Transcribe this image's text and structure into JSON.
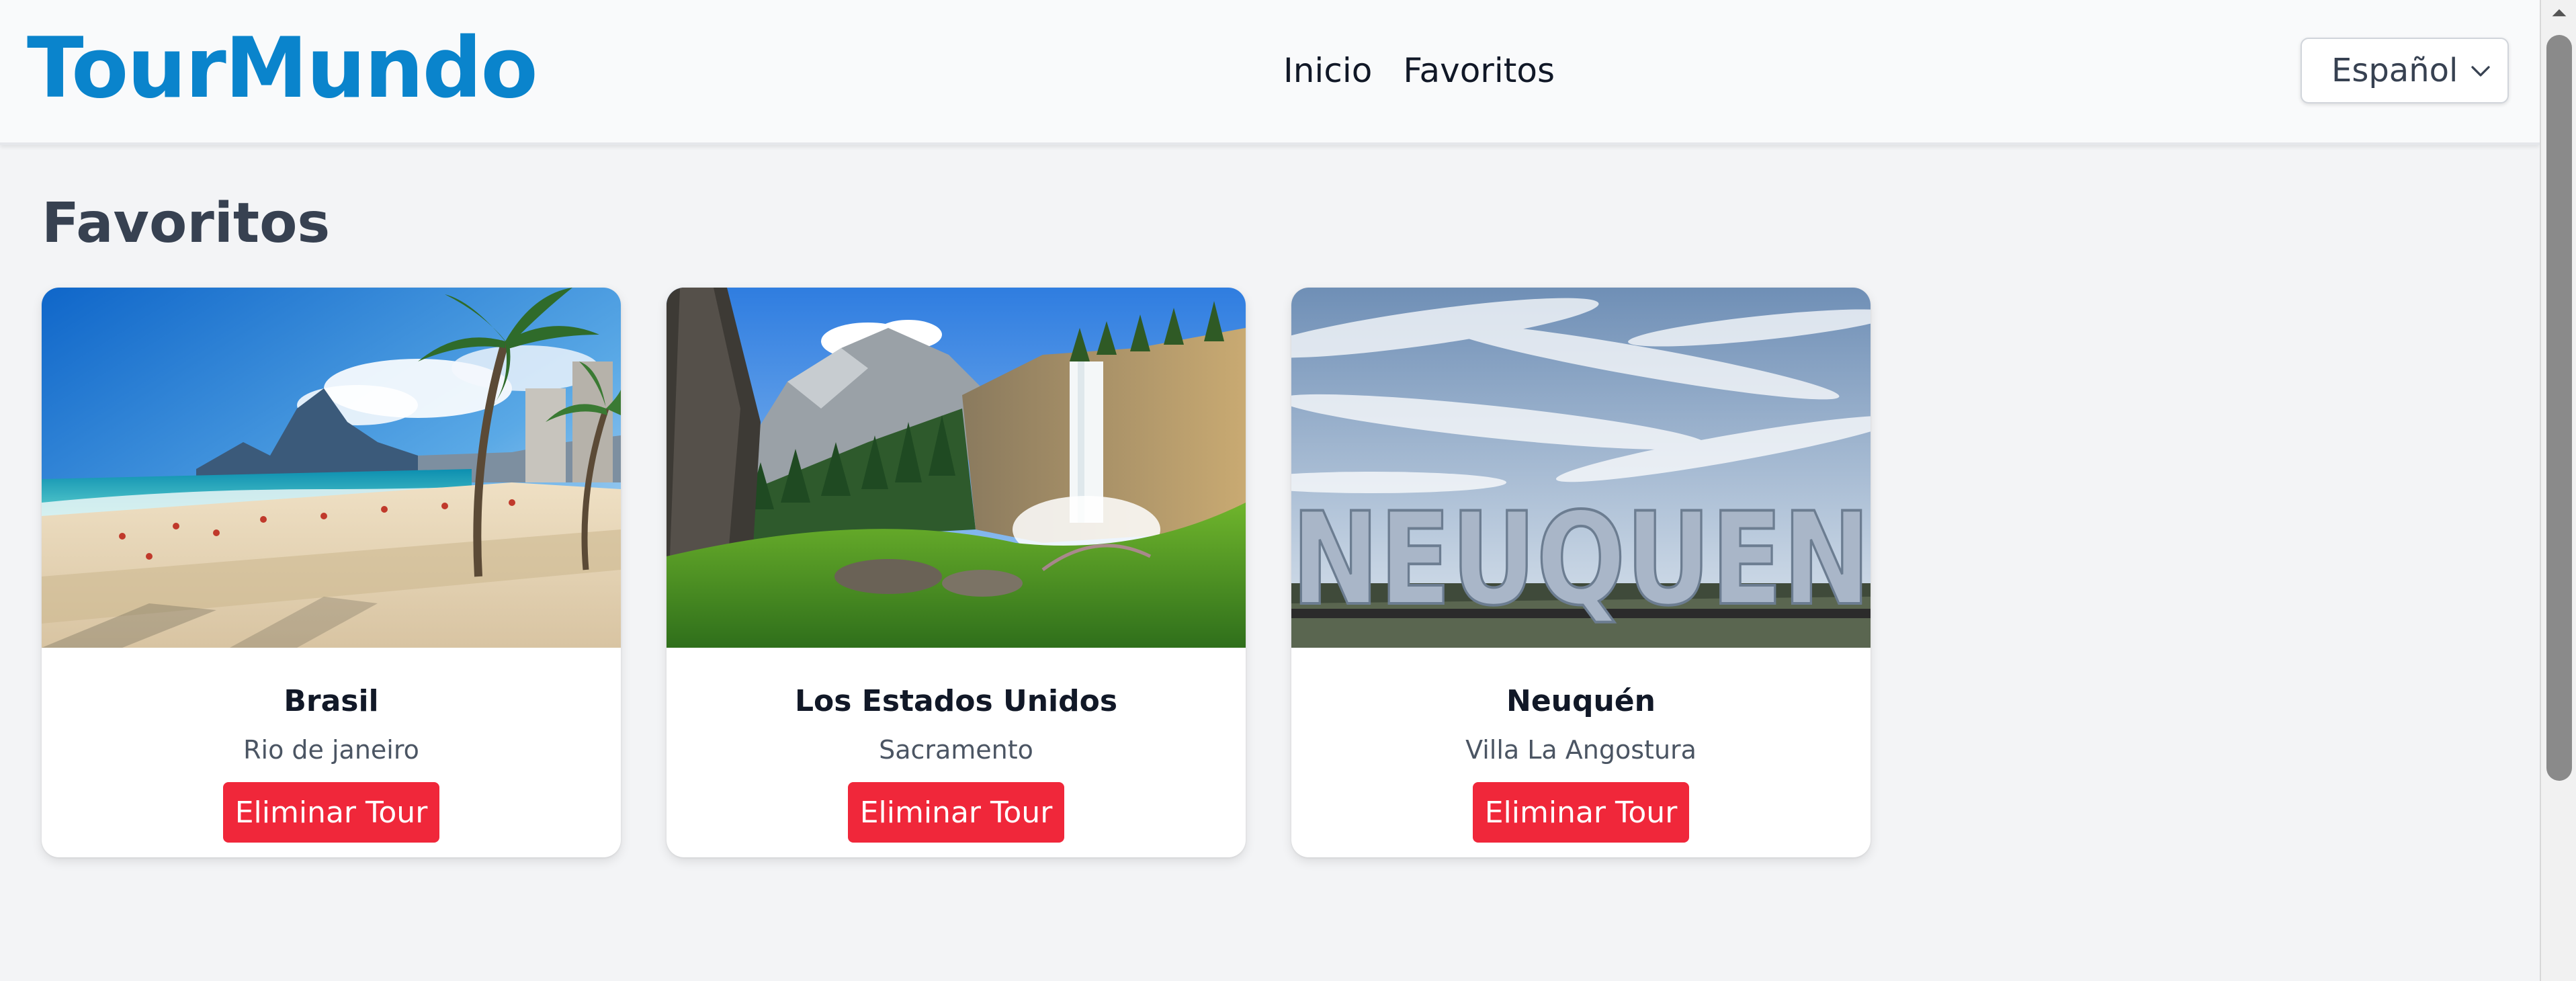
{
  "header": {
    "logo": "TourMundo",
    "nav": [
      "Inicio",
      "Favoritos"
    ],
    "language": "Español"
  },
  "main": {
    "title": "Favoritos",
    "cards": [
      {
        "country": "Brasil",
        "city": "Rio de janeiro",
        "button": "Eliminar Tour",
        "image": "beach-with-palm-trees"
      },
      {
        "country": "Los Estados Unidos",
        "city": "Sacramento",
        "button": "Eliminar Tour",
        "image": "mountain-waterfall"
      },
      {
        "country": "Neuquén",
        "city": "Villa La Angostura",
        "button": "Eliminar Tour",
        "image": "neuquen-letters-sign",
        "sign_text": "NEUQUEN"
      }
    ]
  },
  "colors": {
    "brand": "#0a84cc",
    "danger": "#f0273a",
    "background": "#f3f4f6"
  }
}
